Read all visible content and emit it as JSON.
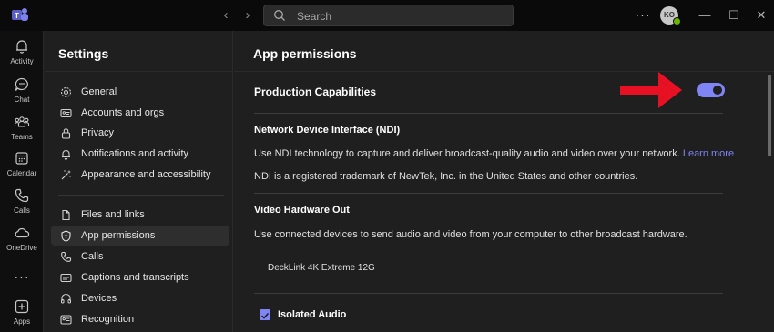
{
  "titlebar": {
    "search_placeholder": "Search",
    "more_label": "···",
    "avatar_initials": "KO",
    "nav_back_glyph": "‹",
    "nav_forward_glyph": "›",
    "minimize_glyph": "—",
    "maximize_glyph": "☐",
    "close_glyph": "✕"
  },
  "rail": {
    "items": [
      {
        "label": "Activity",
        "icon": "bell-icon"
      },
      {
        "label": "Chat",
        "icon": "chat-icon"
      },
      {
        "label": "Teams",
        "icon": "teams-icon"
      },
      {
        "label": "Calendar",
        "icon": "calendar-icon"
      },
      {
        "label": "Calls",
        "icon": "phone-icon"
      },
      {
        "label": "OneDrive",
        "icon": "cloud-icon"
      }
    ],
    "more_label": "···",
    "apps_label": "Apps"
  },
  "settings": {
    "title": "Settings",
    "items": [
      {
        "label": "General",
        "icon": "gear-icon"
      },
      {
        "label": "Accounts and orgs",
        "icon": "id-card-icon"
      },
      {
        "label": "Privacy",
        "icon": "lock-icon"
      },
      {
        "label": "Notifications and activity",
        "icon": "bell-icon"
      },
      {
        "label": "Appearance and accessibility",
        "icon": "wand-icon"
      },
      {
        "label": "Files and links",
        "icon": "file-icon"
      },
      {
        "label": "App permissions",
        "icon": "shield-icon"
      },
      {
        "label": "Calls",
        "icon": "phone-icon"
      },
      {
        "label": "Captions and transcripts",
        "icon": "captions-icon"
      },
      {
        "label": "Devices",
        "icon": "devices-icon"
      },
      {
        "label": "Recognition",
        "icon": "recognition-icon"
      }
    ],
    "active_index": 6
  },
  "main": {
    "title": "App permissions",
    "section_title": "Production Capabilities",
    "toggle_on": true,
    "ndi": {
      "heading": "Network Device Interface (NDI)",
      "description": "Use NDI technology to capture and deliver broadcast-quality audio and video over your network.",
      "learn_more": "Learn more",
      "trademark": "NDI is a registered trademark of NewTek, Inc. in the United States and other countries."
    },
    "hardware": {
      "heading": "Video Hardware Out",
      "description": "Use connected devices to send audio and video from your computer to other broadcast hardware.",
      "device": "DeckLink 4K Extreme 12G"
    },
    "isolated_audio": {
      "label": "Isolated Audio",
      "checked": true
    }
  },
  "colors": {
    "accent": "#7f85f5",
    "annotation_arrow": "#e81123",
    "presence": "#6bb700"
  }
}
